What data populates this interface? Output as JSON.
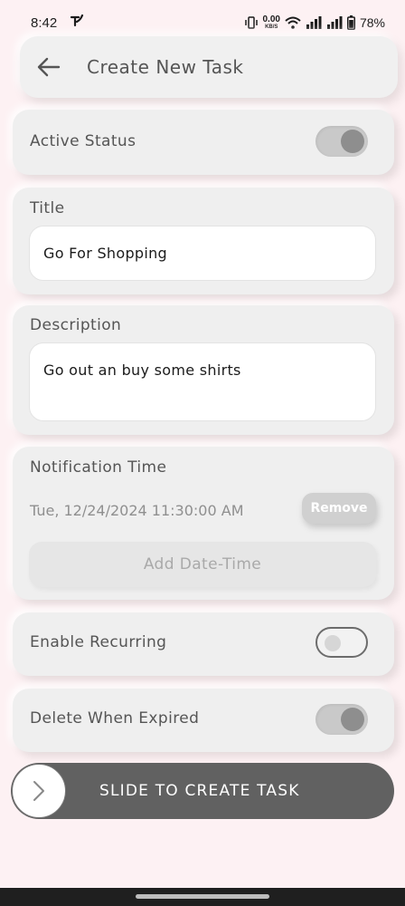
{
  "status_bar": {
    "time": "8:42",
    "net_speed_value": "0.00",
    "net_speed_unit": "KB/S",
    "battery": "78%"
  },
  "header": {
    "title": "Create New Task"
  },
  "active_status": {
    "label": "Active Status",
    "enabled": true
  },
  "title_field": {
    "label": "Title",
    "value": "Go For Shopping"
  },
  "description_field": {
    "label": "Description",
    "value": "Go out an buy some shirts"
  },
  "notification": {
    "label": "Notification Time",
    "datetime": "Tue, 12/24/2024 11:30:00 AM",
    "remove_label": "Remove",
    "add_label": "Add Date-Time"
  },
  "recurring": {
    "label": "Enable Recurring",
    "enabled": false
  },
  "delete_expired": {
    "label": "Delete When Expired",
    "enabled": true
  },
  "slider": {
    "label": "SLIDE TO CREATE TASK"
  },
  "colors": {
    "background": "#fdf1f3",
    "card": "#efefef",
    "slider": "#616161"
  }
}
